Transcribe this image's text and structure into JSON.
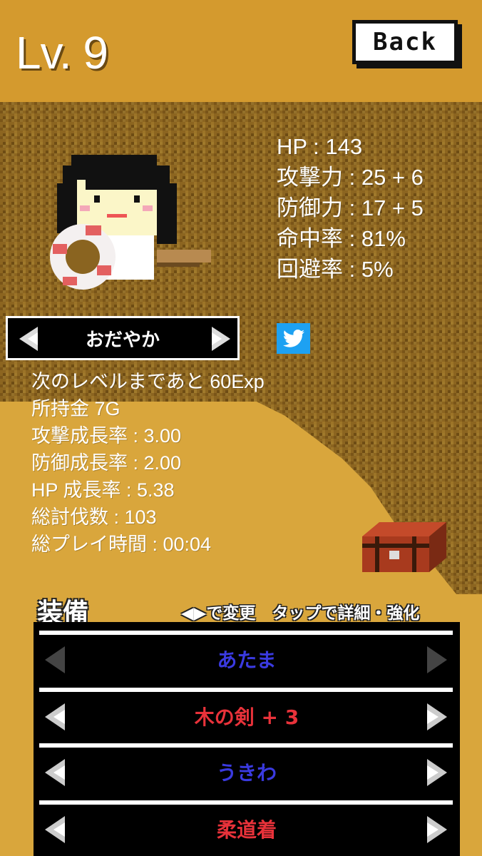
{
  "header": {
    "level": "Lv. 9",
    "back_label": "Back"
  },
  "stats": {
    "hp": "HP : 143",
    "attack": "攻撃力 : 25 + 6",
    "defense": "防御力 : 17 + 5",
    "accuracy": "命中率 : 81%",
    "evasion": "回避率 : 5%"
  },
  "personality": {
    "label": "おだやか"
  },
  "info": {
    "next_level": "次のレベルまであと 60Exp",
    "gold": "所持金 7G",
    "attack_growth": "攻撃成長率 : 3.00",
    "defense_growth": "防御成長率 : 2.00",
    "hp_growth": "HP 成長率 : 5.38",
    "kills": "総討伐数 : 103",
    "playtime": "総プレイ時間 : 00:04"
  },
  "equipment": {
    "title": "装備",
    "hint": "◀▶で変更　タップで詳細・強化",
    "slots": [
      {
        "label": "あたま",
        "color": "#3a3ae0"
      },
      {
        "label": "木の剣 + 3",
        "color": "#e8323a"
      },
      {
        "label": "うきわ",
        "color": "#3a3ae0"
      },
      {
        "label": "柔道着",
        "color": "#e8323a"
      }
    ]
  },
  "icons": [
    "twitter-icon",
    "treasure-chest-icon",
    "left-arrow-icon",
    "right-arrow-icon"
  ],
  "colors": {
    "header_bg": "#d49a2e",
    "dirt": "#8a6420",
    "panel": "#000000"
  }
}
